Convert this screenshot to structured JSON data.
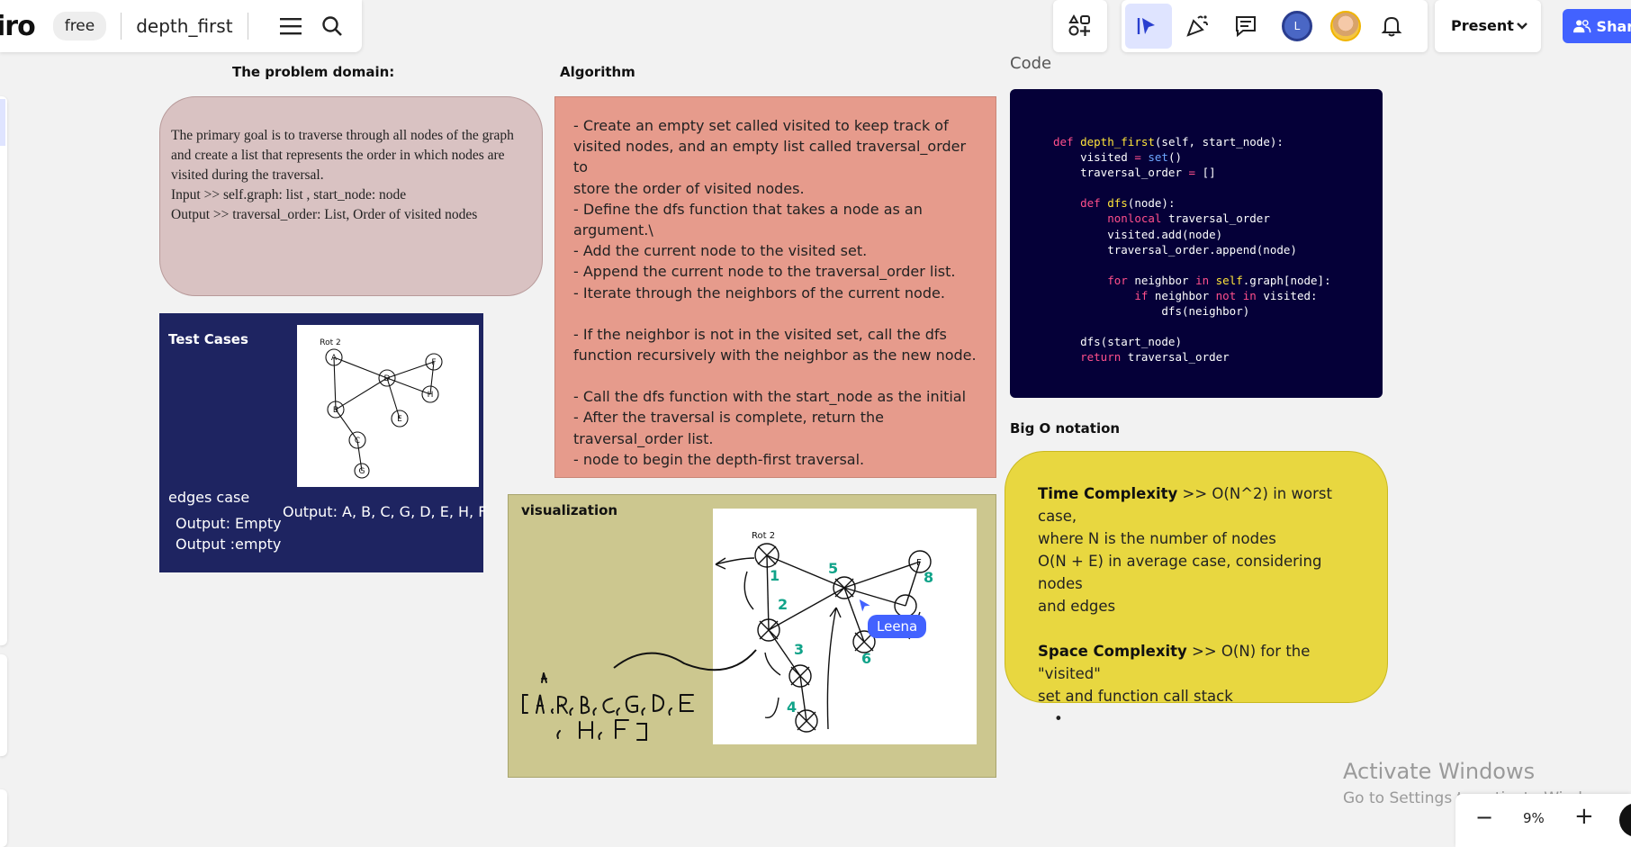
{
  "toolbar": {
    "logo": "iro",
    "plan": "free",
    "board_name": "depth_first"
  },
  "top_right": {
    "present": "Present",
    "share": "Share",
    "avatar_initial": "L"
  },
  "sections": {
    "problem_heading": "The problem domain:",
    "algorithm_heading": "Algorithm",
    "code_heading": "Code",
    "bigo_heading": "Big O notation"
  },
  "problem": {
    "lines": [
      "The primary goal is to traverse through all nodes of the graph",
      "and create a list that represents the order in which nodes are",
      "visited during the traversal.",
      "Input >> self.graph:  list , start_node:  node",
      "Output >> traversal_order: List, Order of visited nodes"
    ]
  },
  "algorithm": {
    "lines": [
      "- Create an empty set called visited to keep track of",
      "visited nodes, and an empty list called traversal_order to",
      "store the order of visited nodes.",
      "- Define the dfs function that takes a node as an",
      "argument.\\",
      "- Add the current node to the visited set.",
      "- Append the current node to the traversal_order list.",
      "- Iterate through the neighbors of the current node.",
      "",
      "- If the neighbor is not in the visited set, call the dfs",
      "function recursively with the neighbor as the new node.",
      "",
      "- Call the dfs function with the start_node as the initial",
      "- After the traversal is complete, return the",
      "traversal_order list.",
      "- node to begin the depth-first traversal."
    ]
  },
  "code": {
    "lines": [
      "def depth_first(self, start_node):",
      "    visited = set()",
      "    traversal_order = []",
      "",
      "    def dfs(node):",
      "        nonlocal traversal_order",
      "        visited.add(node)",
      "        traversal_order.append(node)",
      "",
      "        for neighbor in self.graph[node]:",
      "            if neighbor not in visited:",
      "                dfs(neighbor)",
      "",
      "    dfs(start_node)",
      "    return traversal_order"
    ]
  },
  "test_cases": {
    "title": "Test Cases",
    "edges_label": "edges case",
    "output_main": "Output: A, B, C, G, D, E, H, F",
    "output_empty_1": "Output: Empty",
    "output_empty_2": "Output :empty"
  },
  "visualization": {
    "title": "visualization",
    "cursor_user": "Leena"
  },
  "bigo": {
    "time_label": "Time Complexity",
    "time_text_1": " >> O(N^2) in worst case,",
    "time_text_2": "where N is the number of nodes",
    "time_text_3": "O(N + E) in average case, considering nodes",
    "time_text_4": "and edges",
    "space_label": "Space Complexity",
    "space_text_1": " >> O(N) for the \"visited\"",
    "space_text_2": "set and function call stack",
    "bullet": "•"
  },
  "watermark": {
    "title": "Activate Windows",
    "subtitle": "Go to Settings to activate Windows."
  },
  "zoom": {
    "value": "9%",
    "minus": "−",
    "plus": "+"
  }
}
